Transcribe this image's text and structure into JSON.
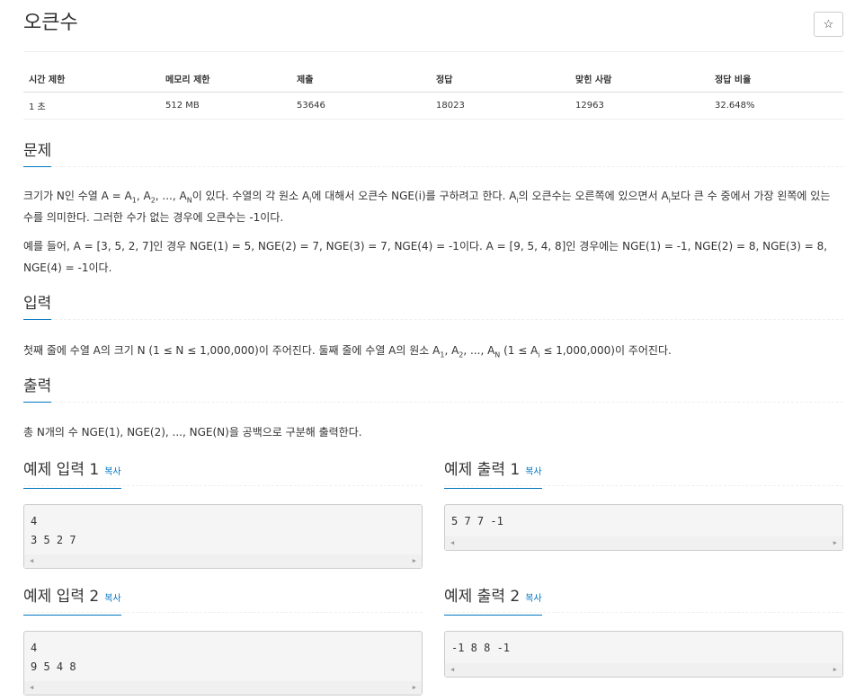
{
  "title": "오큰수",
  "star_label": "☆",
  "stats": {
    "headers": [
      "시간 제한",
      "메모리 제한",
      "제출",
      "정답",
      "맞힌 사람",
      "정답 비율"
    ],
    "values": [
      "1 초",
      "512 MB",
      "53646",
      "18023",
      "12963",
      "32.648%"
    ]
  },
  "sections": {
    "problem": "문제",
    "input": "입력",
    "output": "출력"
  },
  "problem": {
    "p1_a": "크기가 N인 수열 A = A",
    "p1_sub1": "1",
    "p1_b": ", A",
    "p1_sub2": "2",
    "p1_c": ", ..., A",
    "p1_sub3": "N",
    "p1_d": "이 있다. 수열의 각 원소 A",
    "p1_sub4": "i",
    "p1_e": "에 대해서 오큰수 NGE(i)를 구하려고 한다. A",
    "p1_sub5": "i",
    "p1_f": "의 오큰수는 오른쪽에 있으면서 A",
    "p1_sub6": "i",
    "p1_g": "보다 큰 수 중에서 가장 왼쪽에 있는 수를 의미한다. 그러한 수가 없는 경우에 오큰수는 -1이다.",
    "p2": "예를 들어, A = [3, 5, 2, 7]인 경우 NGE(1) = 5, NGE(2) = 7, NGE(3) = 7, NGE(4) = -1이다. A = [9, 5, 4, 8]인 경우에는 NGE(1) = -1, NGE(2) = 8, NGE(3) = 8, NGE(4) = -1이다."
  },
  "input_desc": {
    "a": "첫째 줄에 수열 A의 크기 N (1 ≤ N ≤ 1,000,000)이 주어진다. 둘째 줄에 수열 A의 원소 A",
    "sub1": "1",
    "b": ", A",
    "sub2": "2",
    "c": ", ..., A",
    "sub3": "N",
    "d": " (1 ≤ A",
    "sub4": "i",
    "e": " ≤ 1,000,000)이 주어진다."
  },
  "output_desc": "총 N개의 수 NGE(1), NGE(2), ..., NGE(N)을 공백으로 구분해 출력한다.",
  "copy_label": "복사",
  "samples": [
    {
      "title": "예제 입력 1",
      "content": "4\n3 5 2 7"
    },
    {
      "title": "예제 출력 1",
      "content": "5 7 7 -1"
    },
    {
      "title": "예제 입력 2",
      "content": "4\n9 5 4 8"
    },
    {
      "title": "예제 출력 2",
      "content": "-1 8 8 -1"
    }
  ],
  "scroll_left": "◀",
  "scroll_right": "▶",
  "colors": {
    "accent": "#0076c0"
  }
}
